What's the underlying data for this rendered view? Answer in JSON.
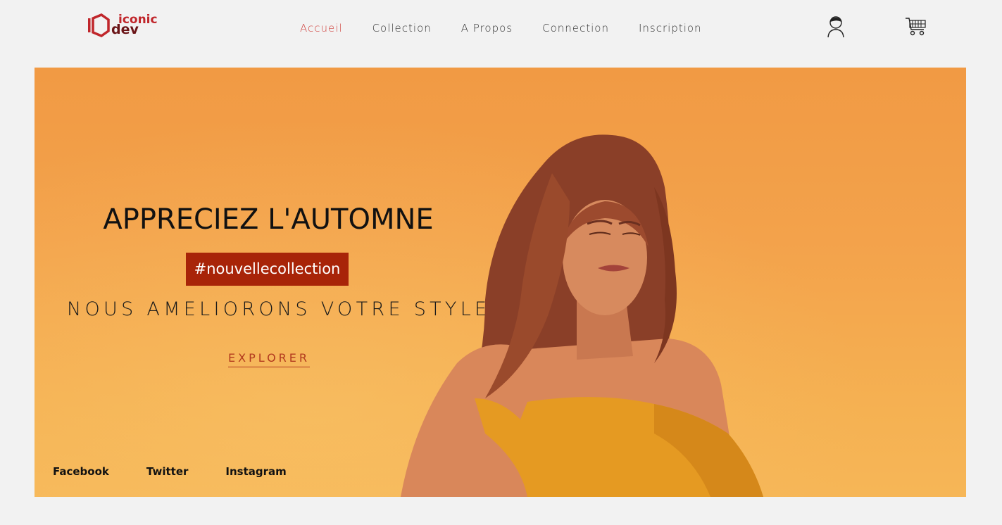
{
  "brand": {
    "word1": "iconic",
    "word2": "dev",
    "color": "#c0262b"
  },
  "nav": {
    "items": [
      {
        "label": "Accueil",
        "active": true
      },
      {
        "label": "Collection",
        "active": false
      },
      {
        "label": "A Propos",
        "active": false
      },
      {
        "label": "Connection",
        "active": false
      },
      {
        "label": "Inscription",
        "active": false
      }
    ]
  },
  "header_icons": {
    "user": "user-icon",
    "cart": "cart-icon"
  },
  "hero": {
    "headline": "APPRECIEZ L'AUTOMNE",
    "tag": "#nouvellecollection",
    "subline": "NOUS AMELIORONS VOTRE STYLE",
    "cta": "EXPLORER",
    "background_color": "#f3a24b",
    "tag_color": "#a82408"
  },
  "social": [
    "Facebook",
    "Twitter",
    "Instagram"
  ]
}
